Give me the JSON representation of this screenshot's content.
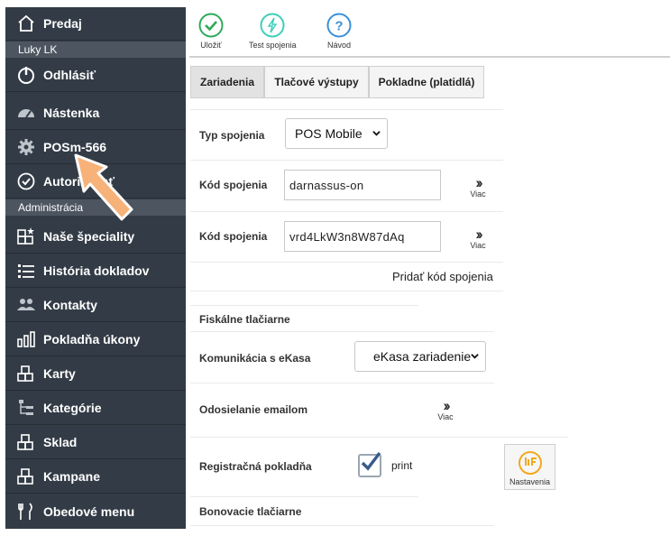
{
  "sidebar": {
    "items": [
      {
        "label": "Predaj",
        "icon": "home-icon"
      },
      {
        "label": "Odhlásiť",
        "icon": "power-icon"
      },
      {
        "label": "Nástenka",
        "icon": "speedometer-icon"
      },
      {
        "label": "POSm-566",
        "icon": "gear-icon"
      },
      {
        "label": "Autorizovať",
        "icon": "check-circle-icon"
      },
      {
        "label": "Naše špeciality",
        "icon": "star-blocks-icon"
      },
      {
        "label": "História dokladov",
        "icon": "list-icon"
      },
      {
        "label": "Kontakty",
        "icon": "users-icon"
      },
      {
        "label": "Pokladňa úkony",
        "icon": "bars-icon"
      },
      {
        "label": "Karty",
        "icon": "blocks-icon"
      },
      {
        "label": "Kategórie",
        "icon": "tree-icon"
      },
      {
        "label": "Sklad",
        "icon": "blocks-icon"
      },
      {
        "label": "Kampane",
        "icon": "blocks-icon"
      },
      {
        "label": "Obedové menu",
        "icon": "cutlery-icon"
      }
    ],
    "user_name": "Luky LK",
    "admin_section": "Administrácia"
  },
  "toolbar": {
    "save_label": "Uložiť",
    "test_label": "Test spojenia",
    "help_label": "Návod"
  },
  "tabs": [
    {
      "label": "Zariadenia",
      "active": true
    },
    {
      "label": "Tlačové výstupy",
      "active": false
    },
    {
      "label": "Pokladne (platidlá)",
      "active": false
    }
  ],
  "form": {
    "typ_spojenia_label": "Typ spojenia",
    "typ_spojenia_value": "POS Mobile",
    "kod1_label": "Kód spojenia",
    "kod1_value": "darnassus-on",
    "kod2_label": "Kód spojenia",
    "kod2_value": "vrd4LkW3n8W87dAq",
    "more_label": "Viac",
    "add_code_label": "Pridať kód spojenia",
    "fiskalne_label": "Fiskálne tlačiarne",
    "komunikacia_label": "Komunikácia s eKasa",
    "komunikacia_value": "eKasa zariadenie",
    "email_label": "Odosielanie emailom",
    "registracna_label": "Registračná pokladňa",
    "registracna_checked": true,
    "print_label": "print",
    "nastavenia_label": "Nastavenia",
    "bonovacie_label": "Bonovacie tlačiarne"
  },
  "colors": {
    "sidebar_bg": "#333c46",
    "sidebar_sub_bg": "#4d5560",
    "save_green": "#2eaa5a",
    "test_teal": "#3ecfb8",
    "help_blue": "#3b8fd8",
    "arrow_orange": "#f7b27a",
    "settings_orange": "#f2a81d"
  }
}
